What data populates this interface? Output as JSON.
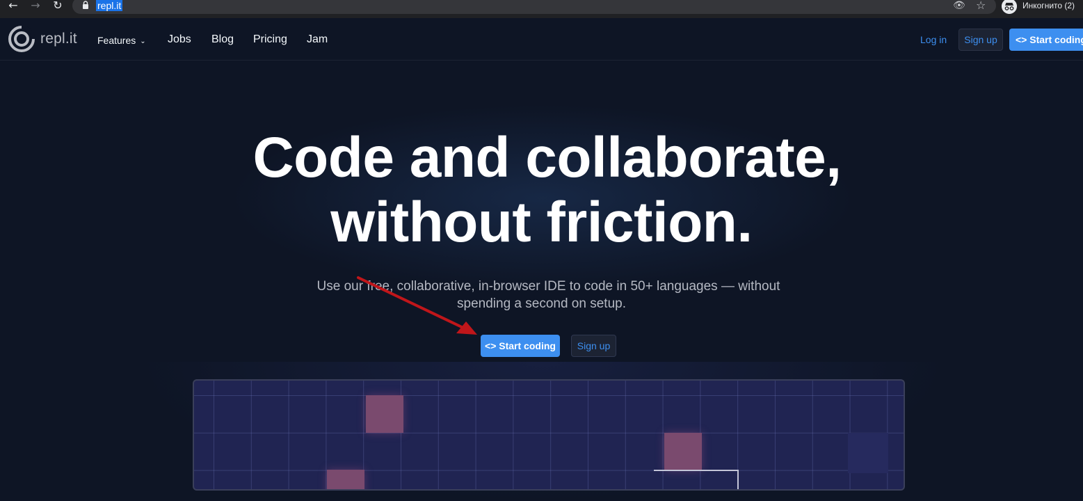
{
  "browser": {
    "url": "repl.it",
    "profile_label": "Инкогнито (2)",
    "icons": {
      "back": "arrow-left-icon",
      "forward": "arrow-right-icon",
      "reload": "reload-icon",
      "lock": "lock-icon",
      "eye": "eye-slash-icon",
      "star": "star-icon",
      "incognito": "incognito-icon"
    }
  },
  "header": {
    "logo_text": "repl.it",
    "nav": {
      "features": "Features",
      "jobs": "Jobs",
      "blog": "Blog",
      "pricing": "Pricing",
      "jam": "Jam"
    },
    "login": "Log in",
    "signup": "Sign up",
    "start_coding": "<> Start coding"
  },
  "hero": {
    "title_line1": "Code and collaborate,",
    "title_line2": "without friction.",
    "subtitle_line1": "Use our free, collaborative, in-browser IDE to code in 50+ languages — without",
    "subtitle_line2": "spending a second on setup.",
    "start_coding": "<> Start coding",
    "signup": "Sign up"
  },
  "colors": {
    "background": "#0e1525",
    "accent_blue": "#3d8ff0",
    "annotation_arrow": "#c0161a",
    "preview_tile": "#7a4a6e"
  }
}
